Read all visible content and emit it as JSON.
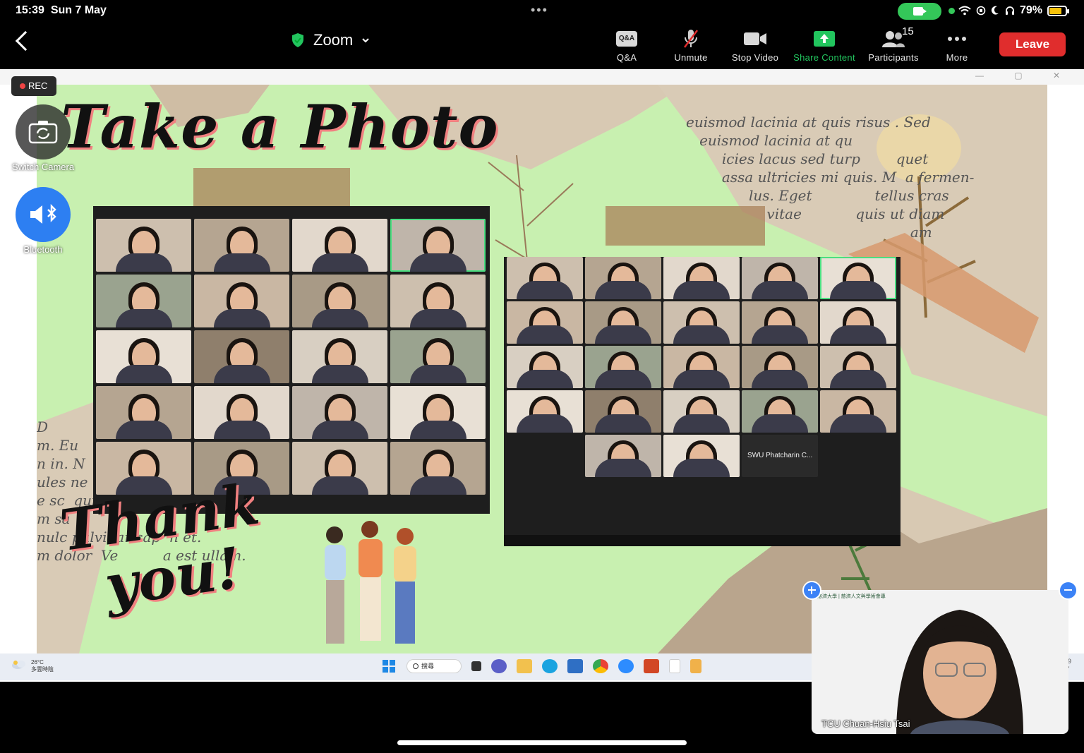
{
  "status_bar": {
    "time": "15:39",
    "date": "Sun 7 May",
    "battery": "79%",
    "battery_level": 0.79,
    "accent_green": "#34c759"
  },
  "toolbar": {
    "meeting_name": "Zoom",
    "qa_icon_text": "Q&A",
    "qa": "Q&A",
    "unmute": "Unmute",
    "stop_video": "Stop Video",
    "share_content": "Share Content",
    "participants": "Participants",
    "participants_count": "15",
    "more": "More",
    "leave": "Leave",
    "leave_color": "#e02d2d"
  },
  "floating": {
    "rec": "REC",
    "switch_camera": "Switch Camera",
    "bluetooth": "Bluetooth"
  },
  "slide": {
    "title": "Take a Photo",
    "thank_line1": "Thank",
    "thank_line2": "you!",
    "paper_right": "euismod lacinia at quis risus . Sed\n   euismod lacinia at qu\n        icies lacus sed turp        quet\n        assa ultricies mi quis. M  a fermen-\n              lus. Eget              tellus cras\n                  vitae            quis ut diam\n                                                  am",
    "paper_left": "D\nm. Eu\nn in. N\nules ne\ne sc  quis\nm sa\nnulc pulvinar sap  n et.\nm dolor  Ve          a est ullam.",
    "gallery2_name_tile": "SWU Phatcharin C..."
  },
  "taskbar": {
    "weather_temp": "26°C",
    "weather_desc": "多雲時陰",
    "search": "搜尋",
    "clock_partial": "19\n/7"
  },
  "self_view": {
    "name": "TCU Chuan-Hsiu Tsai",
    "logo_text": "慈濟大學 | 慈濟人文與學術會專"
  }
}
